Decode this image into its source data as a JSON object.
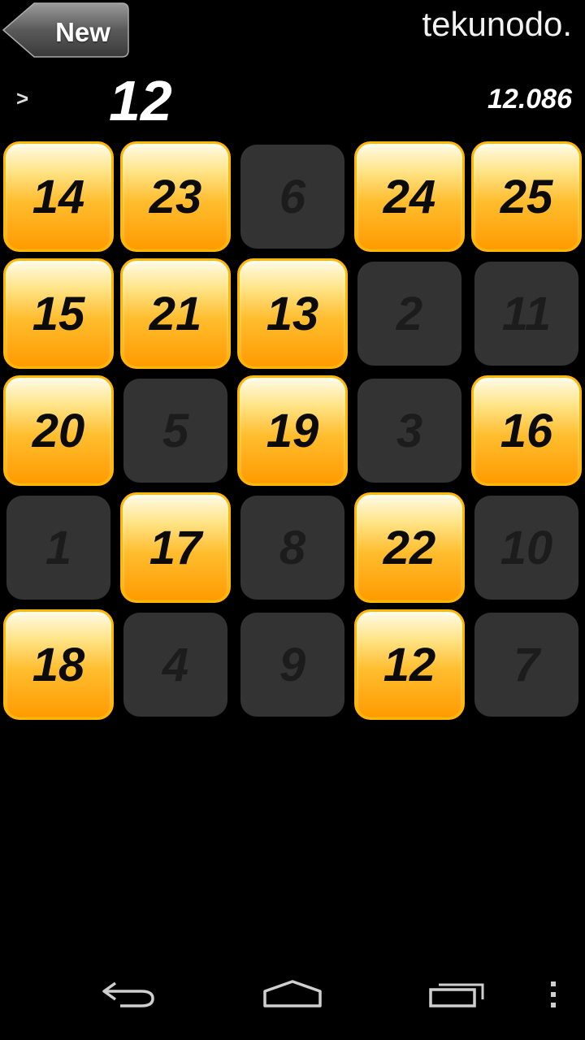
{
  "header": {
    "new_button_label": "New",
    "brand": "tekunodo."
  },
  "status": {
    "arrow": ">",
    "target_number": "12",
    "timer": "12.086"
  },
  "grid": {
    "tiles": [
      {
        "n": "14",
        "state": "on"
      },
      {
        "n": "23",
        "state": "on"
      },
      {
        "n": "6",
        "state": "off"
      },
      {
        "n": "24",
        "state": "on"
      },
      {
        "n": "25",
        "state": "on"
      },
      {
        "n": "15",
        "state": "on"
      },
      {
        "n": "21",
        "state": "on"
      },
      {
        "n": "13",
        "state": "on"
      },
      {
        "n": "2",
        "state": "off"
      },
      {
        "n": "11",
        "state": "off"
      },
      {
        "n": "20",
        "state": "on"
      },
      {
        "n": "5",
        "state": "off"
      },
      {
        "n": "19",
        "state": "on"
      },
      {
        "n": "3",
        "state": "off"
      },
      {
        "n": "16",
        "state": "on"
      },
      {
        "n": "1",
        "state": "off"
      },
      {
        "n": "17",
        "state": "on"
      },
      {
        "n": "8",
        "state": "off"
      },
      {
        "n": "22",
        "state": "on"
      },
      {
        "n": "10",
        "state": "off"
      },
      {
        "n": "18",
        "state": "on"
      },
      {
        "n": "4",
        "state": "off"
      },
      {
        "n": "9",
        "state": "off"
      },
      {
        "n": "12",
        "state": "on"
      },
      {
        "n": "7",
        "state": "off"
      }
    ]
  },
  "colors": {
    "tile_on_top": "#fffbe8",
    "tile_on_bottom": "#ff9b00",
    "tile_on_border": "#ffb800",
    "tile_off": "#333333",
    "background": "#000000"
  },
  "nav": {
    "icons": [
      "back-icon",
      "home-icon",
      "recent-apps-icon",
      "overflow-menu-icon"
    ]
  }
}
